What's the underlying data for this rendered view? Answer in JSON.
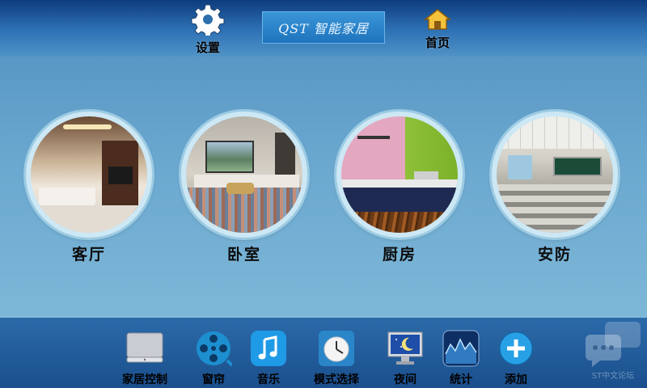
{
  "header": {
    "settings_label": "设置",
    "home_label": "首页",
    "brand_text": "QST 智能家居"
  },
  "rooms": [
    {
      "label": "客厅"
    },
    {
      "label": "卧室"
    },
    {
      "label": "厨房"
    },
    {
      "label": "安防"
    }
  ],
  "dock": {
    "items": [
      {
        "label": "家居控制",
        "icon": "monitor-icon"
      },
      {
        "label": "窗帘",
        "icon": "film-reel-icon"
      },
      {
        "label": "音乐",
        "icon": "music-note-icon"
      },
      {
        "label": "模式选择",
        "icon": "clock-icon"
      },
      {
        "label": "夜间",
        "icon": "night-moon-icon"
      },
      {
        "label": "统计",
        "icon": "statistics-chart-icon"
      },
      {
        "label": "添加",
        "icon": "plus-icon"
      }
    ]
  },
  "watermark": {
    "text": "ST中文论坛"
  },
  "colors": {
    "topbar": "#1f5fa3",
    "dock": "#1f5a98",
    "accent": "#2f8ad6"
  }
}
